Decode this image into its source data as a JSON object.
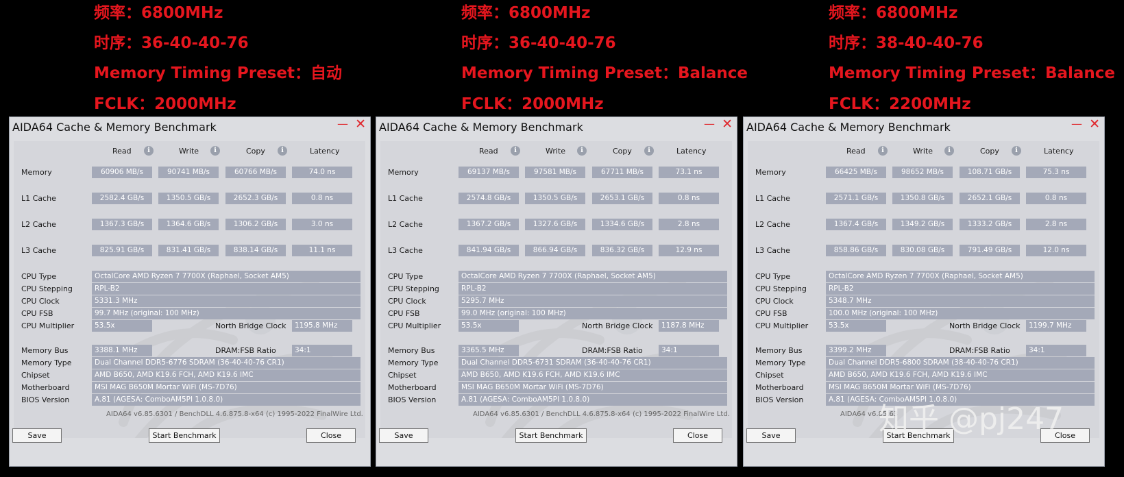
{
  "headers": {
    "read": "Read",
    "write": "Write",
    "copy": "Copy",
    "latency": "Latency",
    "info": "i"
  },
  "labels": {
    "memory": "Memory",
    "l1": "L1 Cache",
    "l2": "L2 Cache",
    "l3": "L3 Cache",
    "cpu_type": "CPU Type",
    "cpu_stepping": "CPU Stepping",
    "cpu_clock": "CPU Clock",
    "cpu_fsb": "CPU FSB",
    "cpu_multiplier": "CPU Multiplier",
    "nb_clock": "North Bridge Clock",
    "memory_bus": "Memory Bus",
    "dram_ratio": "DRAM:FSB Ratio",
    "memory_type": "Memory Type",
    "chipset": "Chipset",
    "motherboard": "Motherboard",
    "bios": "BIOS Version"
  },
  "windows": [
    {
      "banner": [
        "频率：6800MHz",
        "时序：36-40-40-76",
        "Memory Timing Preset：自动",
        "FCLK：2000MHz"
      ],
      "title": "AIDA64 Cache & Memory Benchmark",
      "close_glyph": "✕",
      "min_glyph": "—",
      "rows": [
        [
          "60906 MB/s",
          "90741 MB/s",
          "60766 MB/s",
          "74.0 ns"
        ],
        [
          "2582.4 GB/s",
          "1350.5 GB/s",
          "2652.3 GB/s",
          "0.8 ns"
        ],
        [
          "1367.3 GB/s",
          "1364.6 GB/s",
          "1306.2 GB/s",
          "3.0 ns"
        ],
        [
          "825.91 GB/s",
          "831.41 GB/s",
          "838.14 GB/s",
          "11.1 ns"
        ]
      ],
      "cpu_type": "OctalCore AMD Ryzen 7 7700X  (Raphael, Socket AM5)",
      "cpu_stepping": "RPL-B2",
      "cpu_clock": "5331.3 MHz",
      "cpu_fsb": "99.7 MHz  (original: 100 MHz)",
      "cpu_multiplier": "53.5x",
      "nb_clock": "1195.8 MHz",
      "memory_bus": "3388.1 MHz",
      "dram_ratio": "34:1",
      "memory_type": "Dual Channel DDR5-6776 SDRAM  (36-40-40-76 CR1)",
      "chipset": "AMD B650, AMD K19.6 FCH, AMD K19.6 IMC",
      "motherboard": "MSI MAG B650M Mortar WiFi (MS-7D76)",
      "bios": "A.81  (AGESA: ComboAM5PI 1.0.8.0)",
      "footer": "AIDA64 v6.85.6301 / BenchDLL 4.6.875.8-x64  (c) 1995-2022 FinalWire Ltd.",
      "save": "Save",
      "start": "Start Benchmark",
      "close": "Close"
    },
    {
      "banner": [
        "频率：6800MHz",
        "时序：36-40-40-76",
        "Memory Timing Preset：Balance",
        "FCLK：2000MHz"
      ],
      "title": "AIDA64 Cache & Memory Benchmark",
      "close_glyph": "✕",
      "min_glyph": "—",
      "rows": [
        [
          "69137 MB/s",
          "97581 MB/s",
          "67711 MB/s",
          "73.1 ns"
        ],
        [
          "2574.8 GB/s",
          "1350.5 GB/s",
          "2653.1 GB/s",
          "0.8 ns"
        ],
        [
          "1367.2 GB/s",
          "1327.6 GB/s",
          "1334.6 GB/s",
          "2.8 ns"
        ],
        [
          "841.94 GB/s",
          "866.94 GB/s",
          "836.32 GB/s",
          "12.9 ns"
        ]
      ],
      "cpu_type": "OctalCore AMD Ryzen 7 7700X  (Raphael, Socket AM5)",
      "cpu_stepping": "RPL-B2",
      "cpu_clock": "5295.7 MHz",
      "cpu_fsb": "99.0 MHz  (original: 100 MHz)",
      "cpu_multiplier": "53.5x",
      "nb_clock": "1187.8 MHz",
      "memory_bus": "3365.5 MHz",
      "dram_ratio": "34:1",
      "memory_type": "Dual Channel DDR5-6731 SDRAM  (36-40-40-76 CR1)",
      "chipset": "AMD B650, AMD K19.6 FCH, AMD K19.6 IMC",
      "motherboard": "MSI MAG B650M Mortar WiFi (MS-7D76)",
      "bios": "A.81  (AGESA: ComboAM5PI 1.0.8.0)",
      "footer": "AIDA64 v6.85.6301 / BenchDLL 4.6.875.8-x64  (c) 1995-2022 FinalWire Ltd.",
      "save": "Save",
      "start": "Start Benchmark",
      "close": "Close"
    },
    {
      "banner": [
        "频率：6800MHz",
        "时序：38-40-40-76",
        "Memory Timing Preset：Balance",
        "FCLK：2200MHz"
      ],
      "title": "AIDA64 Cache & Memory Benchmark",
      "close_glyph": "✕",
      "min_glyph": "—",
      "rows": [
        [
          "66425 MB/s",
          "98652 MB/s",
          "108.71 GB/s",
          "75.3 ns"
        ],
        [
          "2571.1 GB/s",
          "1350.8 GB/s",
          "2652.1 GB/s",
          "0.8 ns"
        ],
        [
          "1367.4 GB/s",
          "1349.2 GB/s",
          "1333.2 GB/s",
          "2.8 ns"
        ],
        [
          "858.86 GB/s",
          "830.08 GB/s",
          "791.49 GB/s",
          "12.0 ns"
        ]
      ],
      "cpu_type": "OctalCore AMD Ryzen 7 7700X  (Raphael, Socket AM5)",
      "cpu_stepping": "RPL-B2",
      "cpu_clock": "5348.7 MHz",
      "cpu_fsb": "100.0 MHz  (original: 100 MHz)",
      "cpu_multiplier": "53.5x",
      "nb_clock": "1199.7 MHz",
      "memory_bus": "3399.2 MHz",
      "dram_ratio": "34:1",
      "memory_type": "Dual Channel DDR5-6800 SDRAM  (38-40-40-76 CR1)",
      "chipset": "AMD B650, AMD K19.6 FCH, AMD K19.6 IMC",
      "motherboard": "MSI MAG B650M Mortar WiFi (MS-7D76)",
      "bios": "A.81  (AGESA: ComboAM5PI 1.0.8.0)",
      "footer": "AIDA64 v6.85.63",
      "save": "Save",
      "start": "Start Benchmark",
      "close": "Close"
    }
  ],
  "watermark": "知乎 @pj247",
  "colors": {
    "banner_red": "#e5161e",
    "value_box": "#a4a9b8",
    "panel": "#d5d6db"
  }
}
